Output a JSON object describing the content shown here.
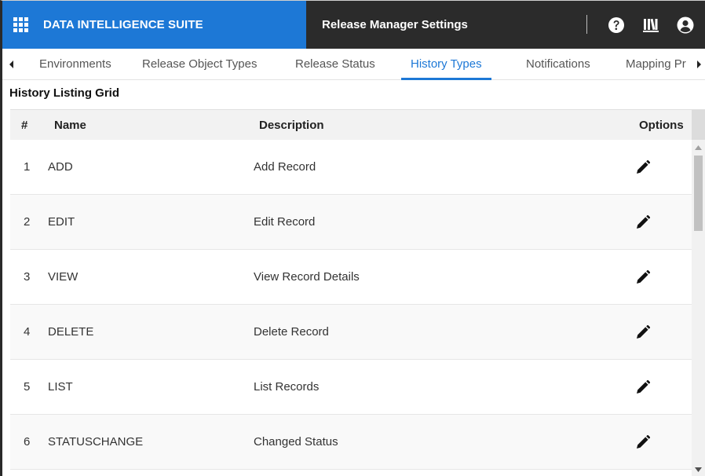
{
  "header": {
    "brand": "DATA INTELLIGENCE SUITE",
    "page_title": "Release Manager Settings",
    "brand_color": "#1d78d6",
    "bar_color": "#2b2b2b"
  },
  "tabs": [
    {
      "label": "Environments",
      "active": false
    },
    {
      "label": "Release Object Types",
      "active": false
    },
    {
      "label": "Release Status",
      "active": false
    },
    {
      "label": "History Types",
      "active": true
    },
    {
      "label": "Notifications",
      "active": false
    },
    {
      "label": "Mapping Pr",
      "active": false
    }
  ],
  "section": {
    "title": "History Listing Grid"
  },
  "grid": {
    "columns": {
      "num": "#",
      "name": "Name",
      "description": "Description",
      "options": "Options"
    },
    "rows": [
      {
        "num": "1",
        "name": "ADD",
        "description": "Add Record"
      },
      {
        "num": "2",
        "name": "EDIT",
        "description": "Edit Record"
      },
      {
        "num": "3",
        "name": "VIEW",
        "description": "View Record Details"
      },
      {
        "num": "4",
        "name": "DELETE",
        "description": "Delete Record"
      },
      {
        "num": "5",
        "name": "LIST",
        "description": "List Records"
      },
      {
        "num": "6",
        "name": "STATUSCHANGE",
        "description": "Changed Status"
      }
    ]
  },
  "icons": {
    "apps": "grid-apps-icon",
    "help": "help-icon",
    "library": "library-icon",
    "user": "user-account-icon",
    "edit": "pencil-edit-icon"
  }
}
